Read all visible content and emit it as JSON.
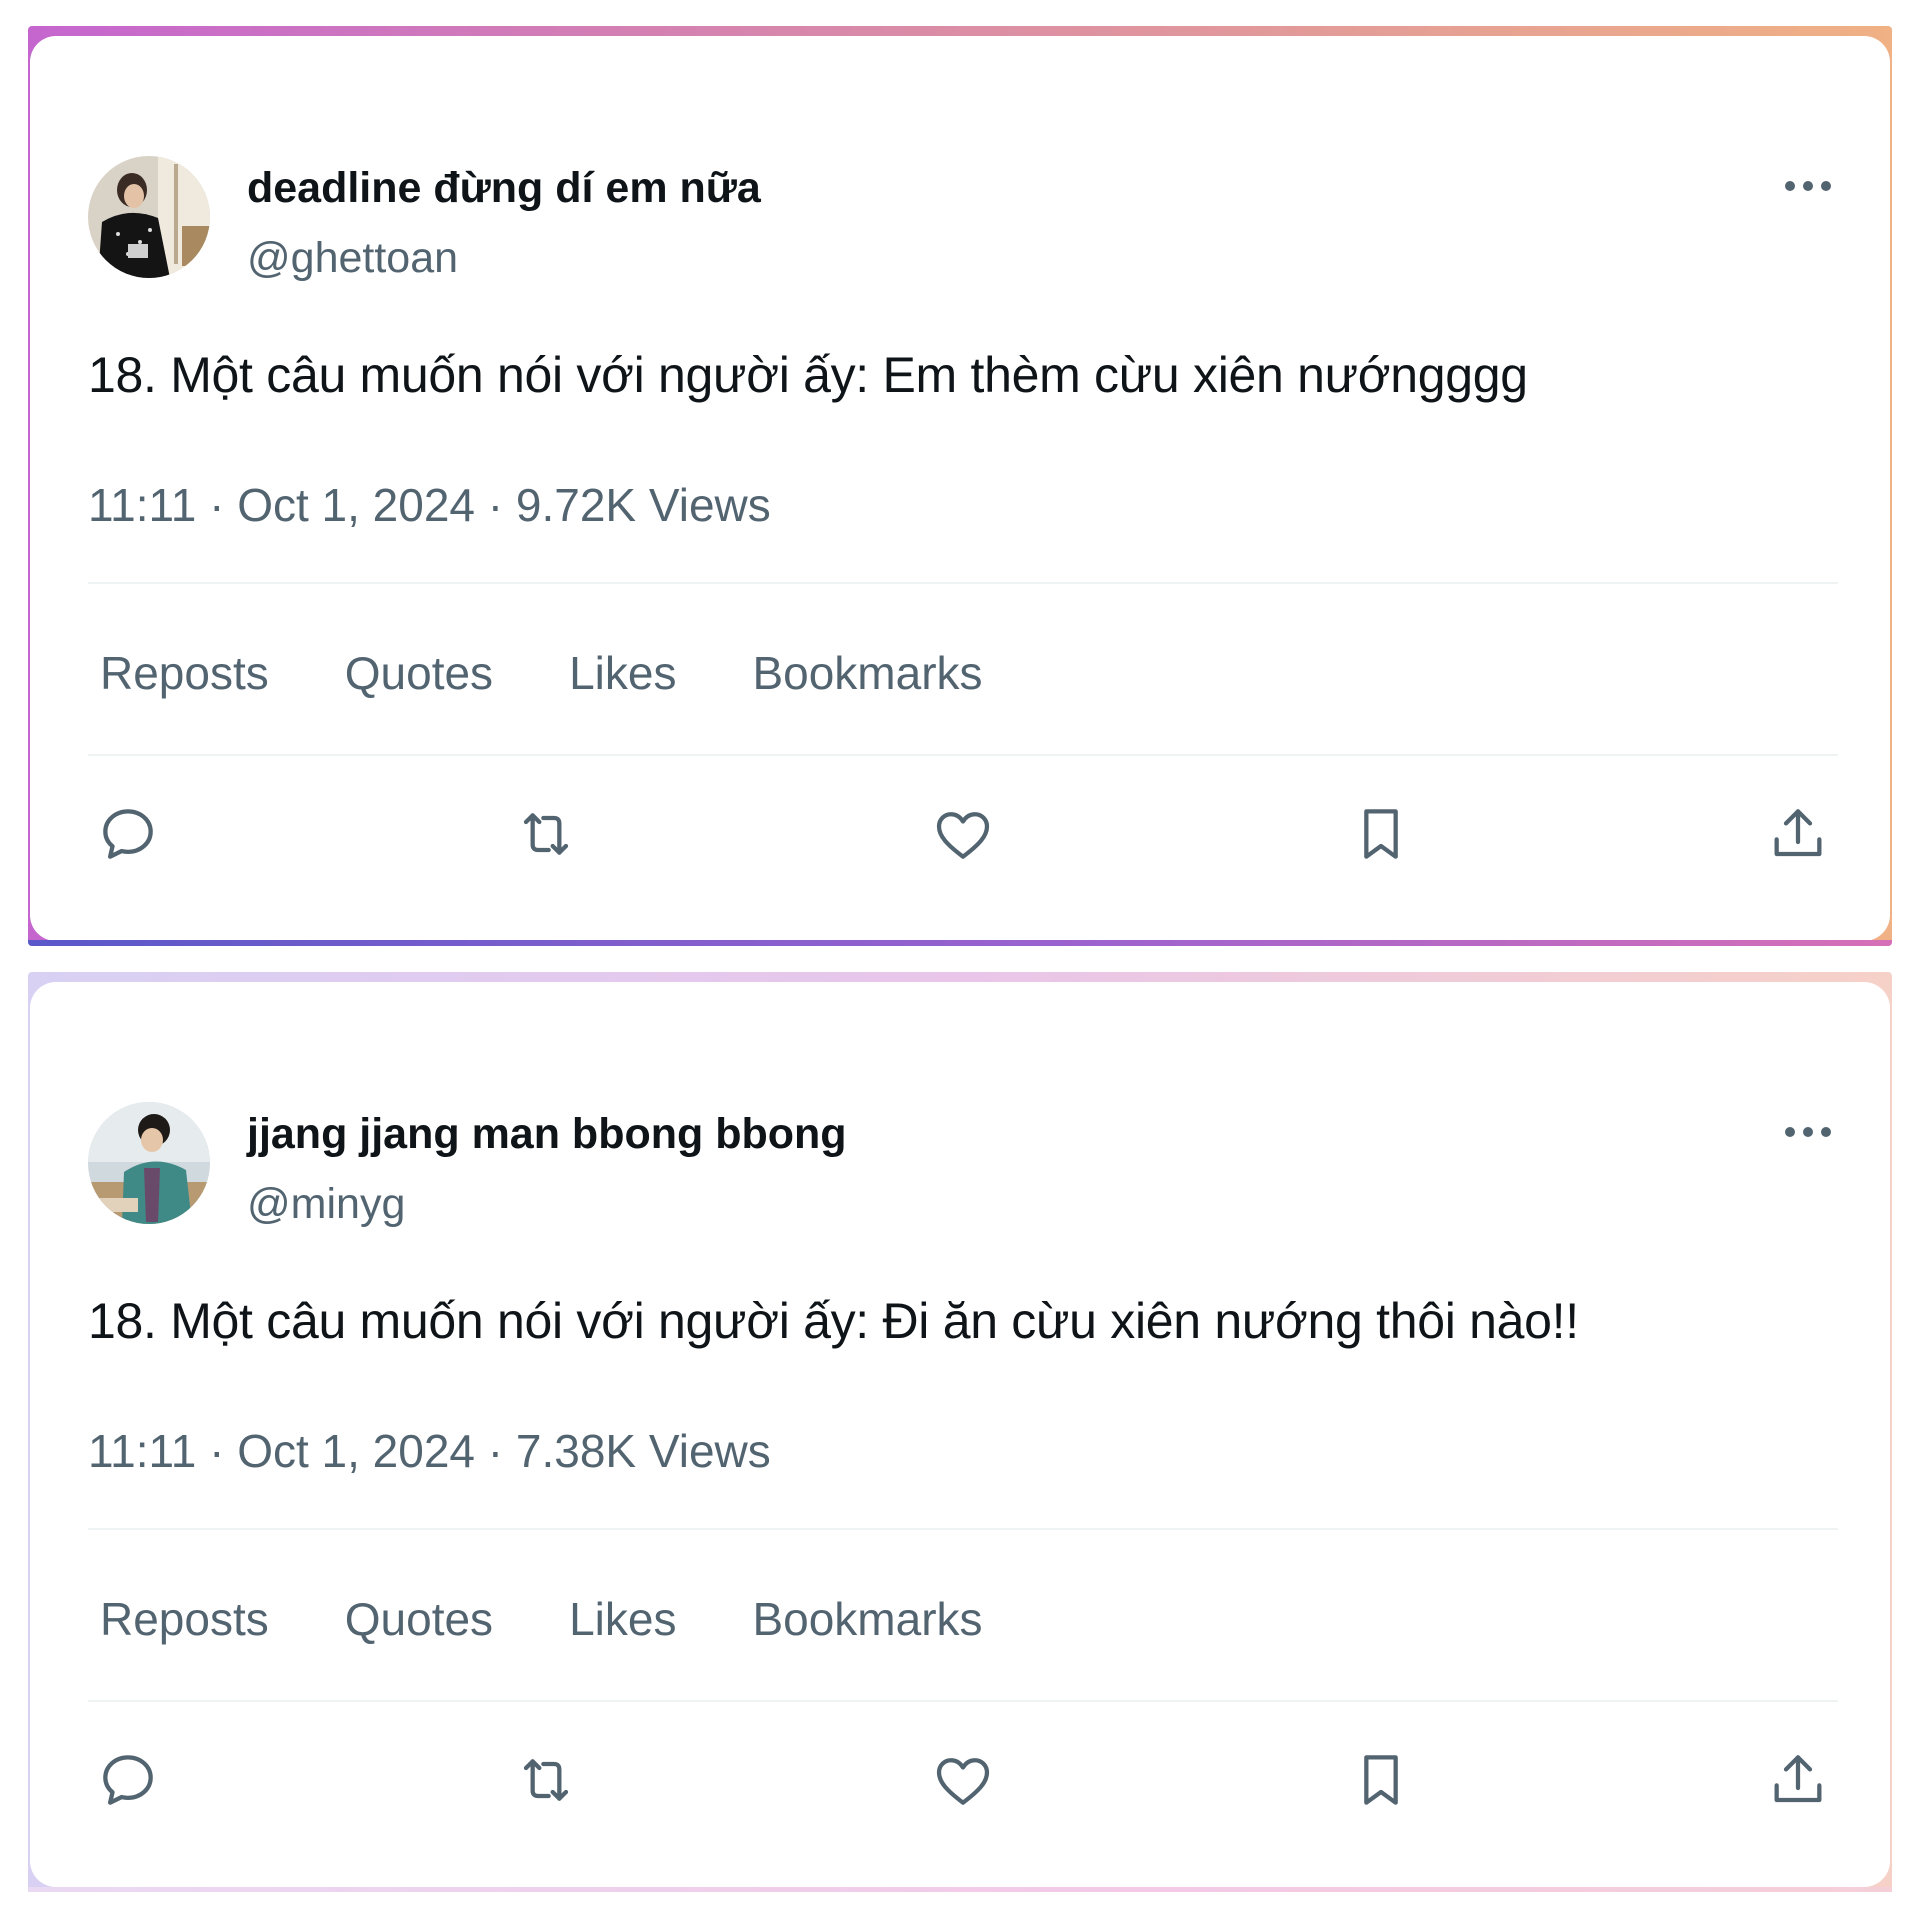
{
  "tweets": [
    {
      "display_name": "deadline đừng dí em nữa",
      "handle": "@ghettoan",
      "text": "18. Một câu muốn nói với người ấy: Em thèm cừu xiên nướngggg",
      "time": "11:11",
      "date": "Oct 1, 2024",
      "views": "9.72K Views",
      "separator": "·",
      "stats": [
        "Reposts",
        "Quotes",
        "Likes",
        "Bookmarks"
      ]
    },
    {
      "display_name": "jjang jjang man bbong bbong",
      "handle": "@minyg",
      "text": "18. Một câu muốn nói với người ấy: Đi ăn cừu xiên nướng thôi nào!!",
      "time": "11:11",
      "date": "Oct 1, 2024",
      "views": "7.38K Views",
      "separator": "·",
      "stats": [
        "Reposts",
        "Quotes",
        "Likes",
        "Bookmarks"
      ]
    }
  ],
  "icons": {
    "more": "more-horizontal-icon",
    "reply": "speech-bubble-icon",
    "repost": "repost-arrows-icon",
    "like": "heart-icon",
    "bookmark": "bookmark-icon",
    "share": "share-upload-icon"
  },
  "colors": {
    "text_primary": "#0f1419",
    "text_secondary": "#536471",
    "divider": "#eff3f4",
    "icon": "#536471"
  }
}
